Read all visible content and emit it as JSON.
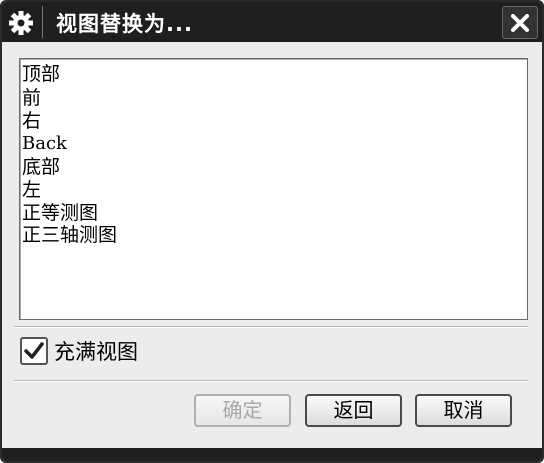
{
  "window": {
    "title": "视图替换为...",
    "icon": "gear-icon",
    "close_icon": "close-icon"
  },
  "list": {
    "items": [
      "顶部",
      "前",
      "右",
      "Back",
      "底部",
      "左",
      "正等测图",
      "正三轴测图"
    ]
  },
  "checkbox": {
    "label": "充满视图",
    "checked": true
  },
  "buttons": {
    "ok": "确定",
    "ok_enabled": false,
    "back": "返回",
    "cancel": "取消"
  }
}
